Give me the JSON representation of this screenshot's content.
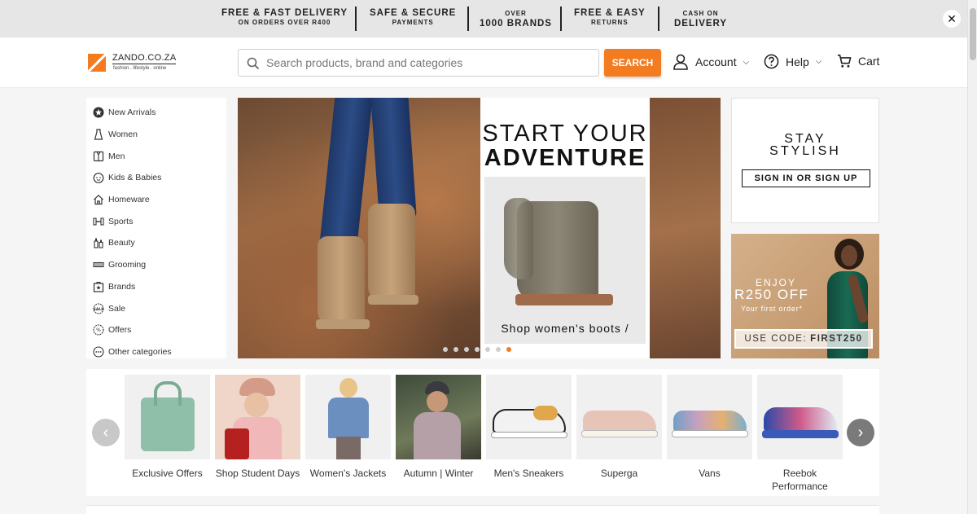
{
  "promo_bar": {
    "items": [
      {
        "line1": "FREE & FAST DELIVERY",
        "line2": "ON ORDERS OVER R400"
      },
      {
        "line1": "SAFE & SECURE",
        "line2": "PAYMENTS"
      },
      {
        "line1": "OVER",
        "line2": "1000 BRANDS"
      },
      {
        "line1": "FREE & EASY",
        "line2": "RETURNS"
      },
      {
        "line1": "CASH ON",
        "line2": "DELIVERY"
      }
    ],
    "close_label": "✕"
  },
  "header": {
    "logo_name": "ZANDO.CO.ZA",
    "logo_tagline": "fashion . lifestyle . online",
    "search_placeholder": "Search products, brand and categories",
    "search_button": "SEARCH",
    "account_label": "Account",
    "help_label": "Help",
    "cart_label": "Cart"
  },
  "sidebar": {
    "items": [
      {
        "label": "New Arrivals",
        "icon": "star-icon"
      },
      {
        "label": "Women",
        "icon": "dress-icon"
      },
      {
        "label": "Men",
        "icon": "shirt-icon"
      },
      {
        "label": "Kids & Babies",
        "icon": "baby-face-icon"
      },
      {
        "label": "Homeware",
        "icon": "home-icon"
      },
      {
        "label": "Sports",
        "icon": "dumbbell-icon"
      },
      {
        "label": "Beauty",
        "icon": "beauty-bottles-icon"
      },
      {
        "label": "Grooming",
        "icon": "razor-icon"
      },
      {
        "label": "Brands",
        "icon": "brand-tag-icon"
      },
      {
        "label": "Sale",
        "icon": "sale-badge-icon"
      },
      {
        "label": "Offers",
        "icon": "offer-badge-icon"
      },
      {
        "label": "Other categories",
        "icon": "more-dots-icon"
      }
    ]
  },
  "hero": {
    "title_line1": "START YOUR",
    "title_line2": "ADVENTURE",
    "cta": "Shop women's boots /",
    "slide_count": 7,
    "active_slide": 7
  },
  "stay_stylish": {
    "title_line1": "STAY",
    "title_line2": "STYLISH",
    "button": "SIGN IN OR SIGN UP"
  },
  "promo_card": {
    "enjoy": "ENJOY",
    "amount": "R250 OFF",
    "subtitle": "Your first order*",
    "code_label": "USE CODE:",
    "code": "FIRST250"
  },
  "categories": [
    {
      "label": "Exclusive Offers"
    },
    {
      "label": "Shop Student Days"
    },
    {
      "label": "Women's Jackets"
    },
    {
      "label": "Autumn | Winter"
    },
    {
      "label": "Men's Sneakers"
    },
    {
      "label": "Superga"
    },
    {
      "label": "Vans"
    },
    {
      "label": "Reebok Performance"
    }
  ],
  "colors": {
    "accent": "#f47c20",
    "promo_bg": "#e6e6e6",
    "page_bg": "#f5f5f5"
  }
}
